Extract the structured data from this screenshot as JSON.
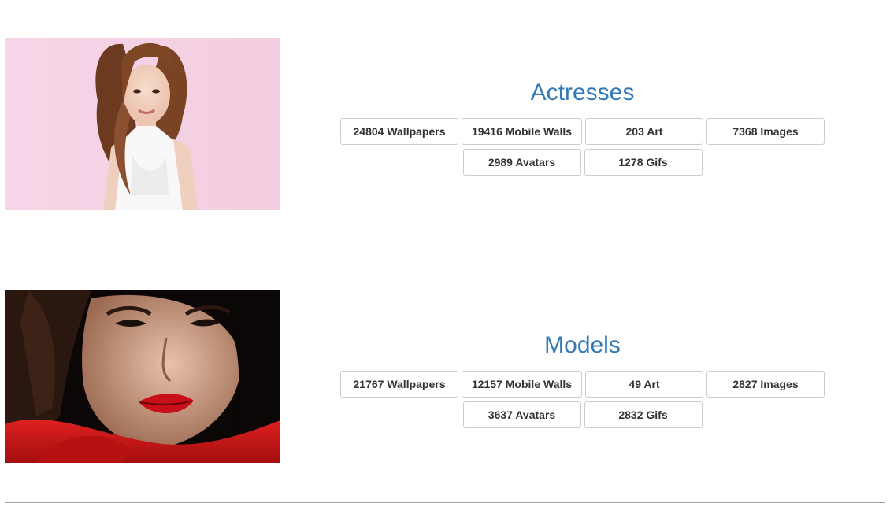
{
  "categories": [
    {
      "title": "Actresses",
      "image_alt": "actress-photo",
      "buttons": {
        "wallpapers": "24804 Wallpapers",
        "mobile_walls": "19416 Mobile Walls",
        "art": "203 Art",
        "images": "7368 Images",
        "avatars": "2989 Avatars",
        "gifs": "1278 Gifs"
      }
    },
    {
      "title": "Models",
      "image_alt": "model-photo",
      "buttons": {
        "wallpapers": "21767 Wallpapers",
        "mobile_walls": "12157 Mobile Walls",
        "art": "49 Art",
        "images": "2827 Images",
        "avatars": "3637 Avatars",
        "gifs": "2832 Gifs"
      }
    }
  ],
  "colors": {
    "title_link": "#337ab7",
    "button_border": "#cccccc",
    "button_text": "#333333",
    "divider": "#a0a0a0"
  }
}
